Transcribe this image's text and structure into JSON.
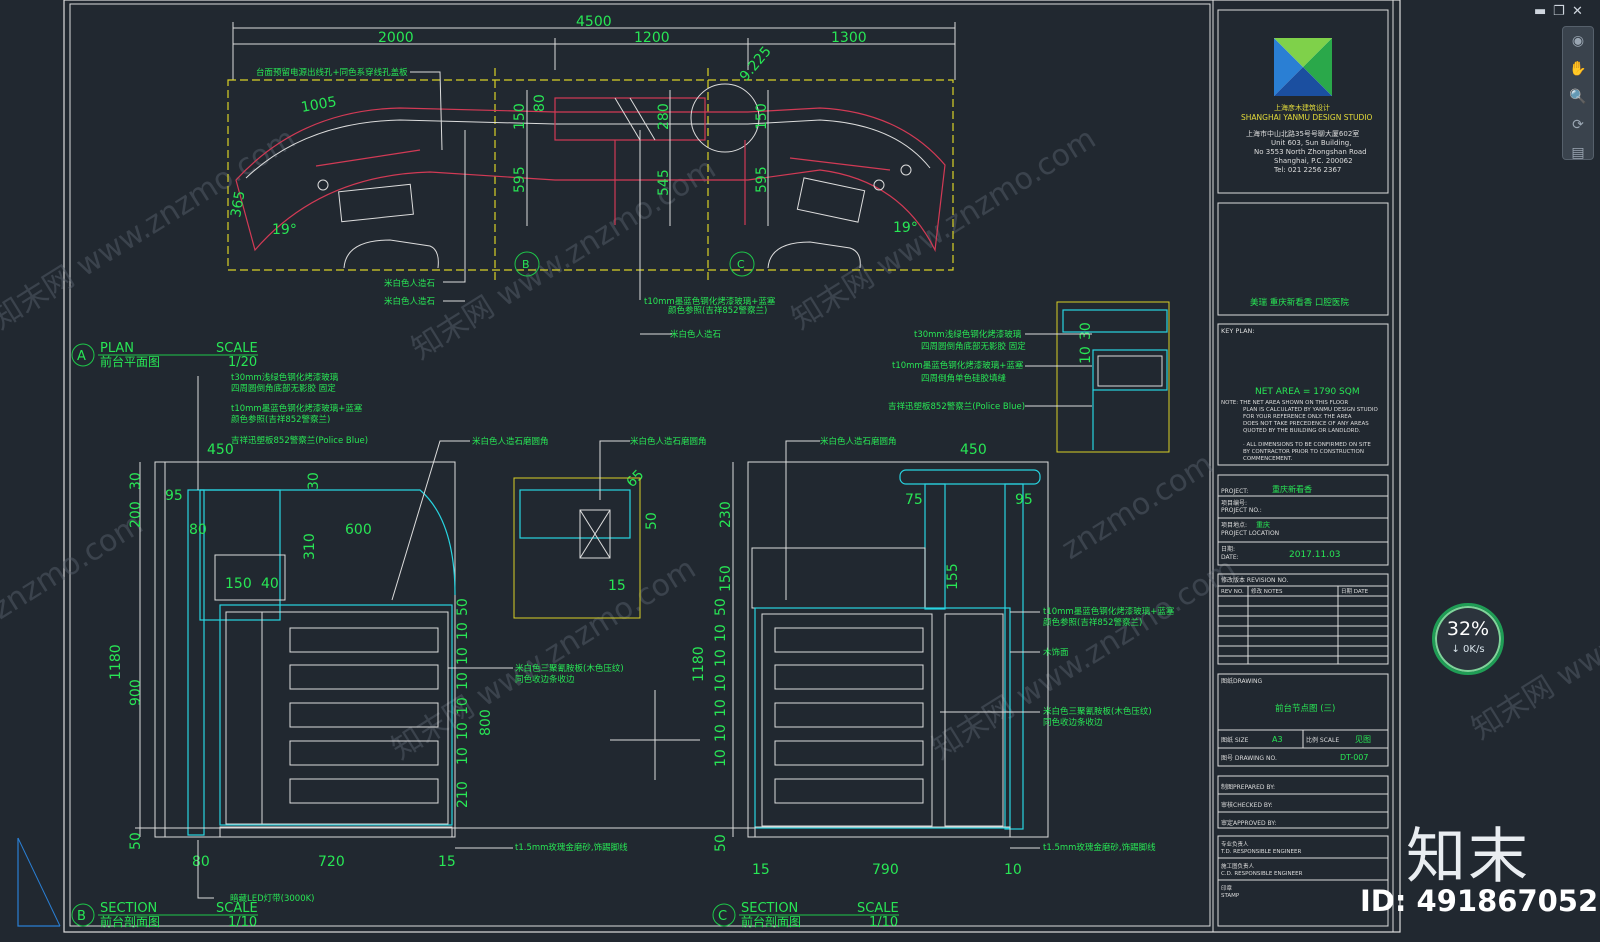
{
  "window": {
    "minimize": "▬",
    "restore": "❐",
    "close": "✕"
  },
  "navbar": {
    "pan": "✋",
    "zoom": "🔍",
    "orbit": "⟳",
    "wheel": "◉",
    "show": "▤"
  },
  "network_widget": {
    "percent": "32%",
    "speed": "↓ 0K/s"
  },
  "brand": {
    "logo_text": "知末",
    "image_id": "ID: 491867052",
    "watermark": "znzmo.com",
    "watermark_cn": "知末网 www.znzmo.com"
  },
  "colors": {
    "bg": "#212830",
    "line_green": "#1ec84a",
    "line_yellow": "#d9d126",
    "line_red": "#d23a55",
    "line_cyan": "#28d4e0",
    "line_white": "#dcdcdc",
    "text_green": "#28e655"
  },
  "plan": {
    "dims_top": [
      "4500",
      "2000",
      "1200",
      "1300"
    ],
    "dims_inner": [
      "1005",
      "80",
      "150",
      "595",
      "280",
      "545",
      "150",
      "595",
      "365",
      "9.225",
      "19°",
      "19°"
    ],
    "notes": [
      "台面预留电源出线孔+同色系穿线孔盖板",
      "米白色人造石",
      "米白色人造石",
      "t10mm墨蓝色钢化烤漆玻璃+蓝塞",
      "颜色参照(吉祥852警察兰)",
      "米白色人造石"
    ],
    "markers": [
      "B",
      "C"
    ],
    "title_letter": "A",
    "title_en": "PLAN",
    "title_cn": "前台平面图",
    "scale_label": "SCALE",
    "scale_value": "1/20"
  },
  "section_b": {
    "notes": [
      "t30mm浅绿色钢化烤漆玻璃",
      "四周圆倒角底部无影胶 固定",
      "t10mm墨蓝色钢化烤漆玻璃+蓝塞",
      "颜色参照(吉祥852警察兰)",
      "吉祥迅塑板852警察兰(Police Blue)",
      "米白色人造石磨圆角",
      "米白色人造石磨圆角",
      "米白色三聚氰胺板(木色压纹)",
      "同色收边条收边",
      "暗藏LED灯带(3000K)"
    ],
    "dims": [
      "450",
      "30",
      "30",
      "95",
      "200",
      "80",
      "600",
      "310",
      "150",
      "40",
      "1180",
      "900",
      "800",
      "210",
      "50",
      "80",
      "720",
      "15",
      "10",
      "10",
      "10",
      "10",
      "10",
      "10",
      "50",
      "65",
      "50",
      "15"
    ],
    "title_letter": "B",
    "title_en": "SECTION",
    "title_cn": "前台剖面图",
    "scale_label": "SCALE",
    "scale_value": "1/10"
  },
  "section_c": {
    "notes": [
      "米白色人造石磨圆角",
      "t10mm墨蓝色钢化烤漆玻璃+蓝塞",
      "颜色参照(吉祥852警察兰)",
      "木饰面",
      "米白色三聚氰胺板(木色压纹)",
      "同色收边条收边",
      "t1.5mm玫瑰金磨砂,饰踢脚线",
      "t1.5mm玫瑰金磨砂,饰踢脚线"
    ],
    "dims": [
      "450",
      "75",
      "95",
      "230",
      "150",
      "155",
      "1180",
      "50",
      "10",
      "10",
      "10",
      "10",
      "10",
      "10",
      "50",
      "15",
      "790",
      "10"
    ],
    "title_letter": "C",
    "title_en": "SECTION",
    "title_cn": "前台剖面图",
    "scale_label": "SCALE",
    "scale_value": "1/10"
  },
  "detail": {
    "notes": [
      "t30mm浅绿色钢化烤漆玻璃",
      "四周圆倒角底部无影胶 固定",
      "t10mm墨蓝色钢化烤漆玻璃+蓝塞",
      "四周倒角单色硅胶填缝",
      "吉祥迅塑板852警察兰(Police Blue)"
    ],
    "dims": [
      "30",
      "10"
    ]
  },
  "title_block": {
    "studio_cn": "上海彦木建筑设计",
    "studio_en": "SHANGHAI YANMU DESIGN STUDIO",
    "address": [
      "上海市中山北路35号号聊大厦602室",
      "Unit 603, Sun Building,",
      "No 3553 North Zhongshan Road",
      "Shanghai, P.C. 200062",
      "Tel: 021 2256 2367"
    ],
    "project_title": "美瑞  重庆新看香  口腔医院",
    "key_plan": "KEY PLAN:",
    "net_area": "NET AREA = 1790 SQM",
    "note_lines": [
      "NOTE:  THE NET AREA SHOWN ON THIS FLOOR",
      "PLAN IS CALCULATED BY YANMU DESIGN STUDIO",
      "FOR YOUR REFERENCE ONLY. THE AREA",
      "DOES NOT TAKE PRECEDENCE OF ANY AREAS",
      "QUOTED BY THE BUILDING OR LANDLORD.",
      "· ALL DIMENSIONS TO BE CONFIRMED ON SITE",
      "BY CONTRACTOR PRIOR TO CONSTRUCTION",
      "COMMENCEMENT."
    ],
    "project_label": "PROJECT:",
    "project_value": "重庆新看香",
    "client_label": "项目编号:",
    "client_sub": "PROJECT NO.:",
    "location_label": "项目地点:",
    "location_value": "重庆",
    "location_sub": "PROJECT LOCATION",
    "date_label": "日期:",
    "date_sub": "DATE:",
    "date_value": "2017.11.03",
    "revision_label": "修改版本 REVISION NO.",
    "rev_cols": [
      "REV NO.",
      "修改 NOTES",
      "日期 DATE"
    ],
    "drawing_label": "图纸DRAWING",
    "drawing_value": "前台节点图 (三)",
    "size_label": "图纸 SIZE",
    "size_value": "A3",
    "scale_label": "比例 SCALE",
    "scale_value": "见图",
    "no_label": "图号 DRAWING NO.",
    "no_value": "DT-007",
    "prepared": "制图PREPARED BY:",
    "checked": "审核CHECKED BY:",
    "approved": "审定APPROVED BY:",
    "td_label": "专业负责人",
    "td_sub": "T.D. RESPONSIBLE ENGINEER",
    "cd_label": "施工图负责人",
    "cd_sub": "C.D. RESPONSIBLE ENGINEER",
    "stamp1": "印章",
    "stamp2": "STAMP"
  }
}
